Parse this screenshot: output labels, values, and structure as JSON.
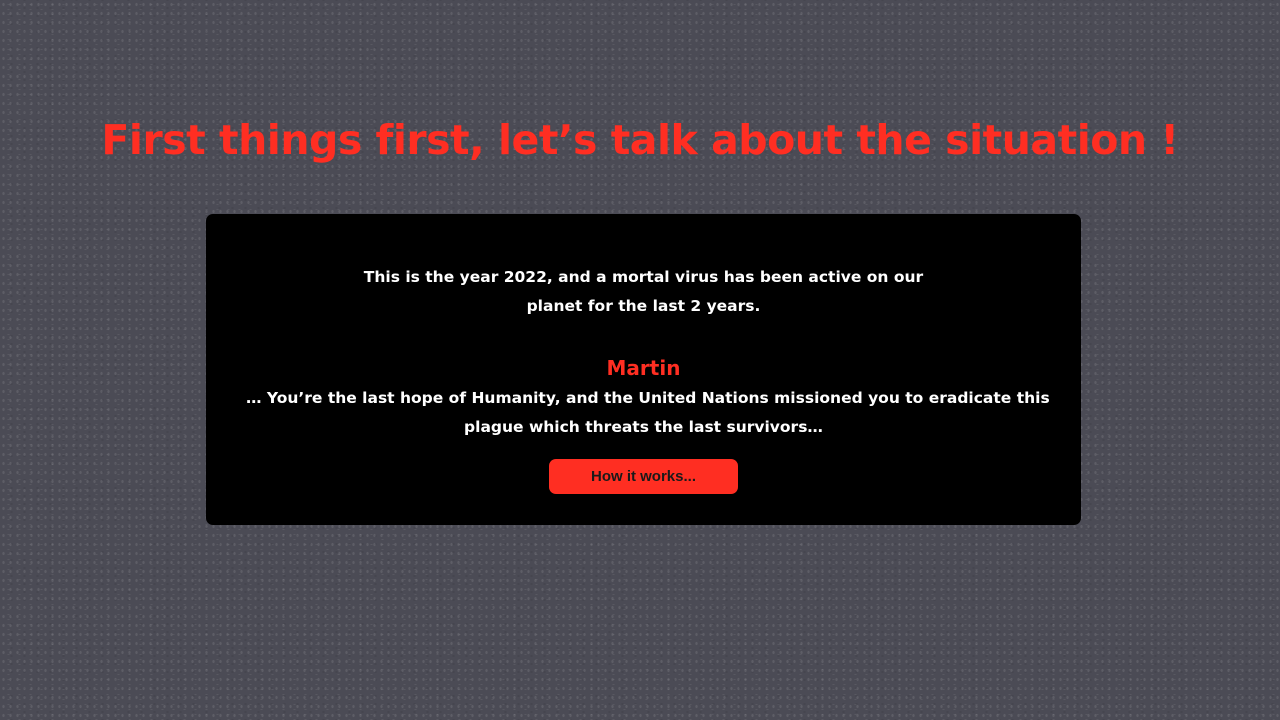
{
  "headline": "First things first, let’s talk about the situation !",
  "panel": {
    "intro_lines": [
      "This is the year 2022, and a mortal virus has been active on our",
      "planet for the last 2 years."
    ],
    "player_name": "Martin",
    "mission_lines": [
      "… You’re the last hope of Humanity, and the United Nations missioned you to eradicate this",
      "plague which threats the last survivors…"
    ],
    "button_label": "How it works..."
  },
  "colors": {
    "background": "#4b4b55",
    "panel": "#000000",
    "accent": "#ff2e22",
    "text": "#ffffff"
  }
}
